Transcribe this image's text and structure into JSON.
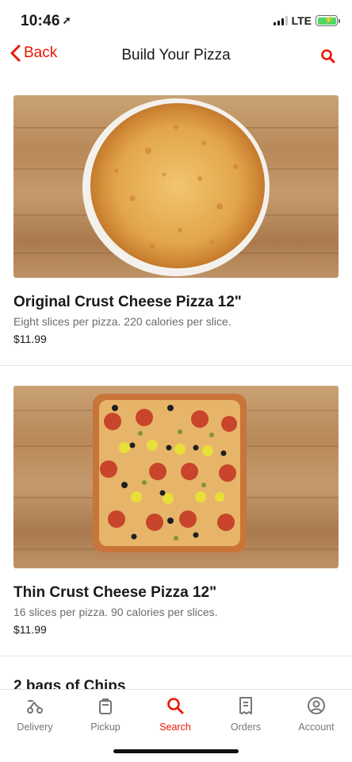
{
  "status_bar": {
    "time": "10:46",
    "network": "LTE"
  },
  "nav": {
    "back_label": "Back",
    "title": "Build Your Pizza",
    "search_icon": "search-icon"
  },
  "items": [
    {
      "name": "Original Crust Cheese Pizza 12\"",
      "description": "Eight slices per pizza. 220 calories per slice.",
      "price": "$11.99"
    },
    {
      "name": "Thin Crust Cheese Pizza 12\"",
      "description": "16 slices per pizza. 90 calories per slices.",
      "price": "$11.99"
    },
    {
      "name": "2 bags of Chips"
    }
  ],
  "tab_bar": {
    "active": "Search",
    "tabs": [
      {
        "label": "Delivery",
        "icon": "scooter-icon"
      },
      {
        "label": "Pickup",
        "icon": "bag-icon"
      },
      {
        "label": "Search",
        "icon": "search-icon"
      },
      {
        "label": "Orders",
        "icon": "receipt-icon"
      },
      {
        "label": "Account",
        "icon": "account-icon"
      }
    ]
  },
  "colors": {
    "accent": "#eb1700",
    "text_primary": "#191919",
    "text_secondary": "#6b6b6b",
    "tab_inactive": "#767676"
  }
}
